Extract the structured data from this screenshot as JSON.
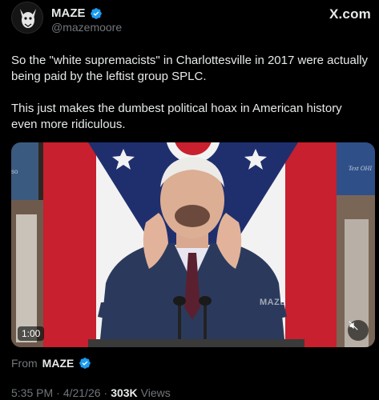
{
  "author": {
    "display_name": "MAZE",
    "handle": "@mazemoore",
    "verified_color": "#1d9bf0"
  },
  "site_logo": "X.com",
  "post": {
    "paragraph_1": "So the \"white supremacists\" in Charlottesville in 2017 were actually being paid by the leftist group SPLC.",
    "paragraph_2": "This just makes the dumbest political hoax in American history even more ridiculous."
  },
  "media": {
    "duration": "1:00",
    "watermark": "MAZE",
    "sign_text_right": "Text OHI",
    "sign_text_left": "so"
  },
  "from": {
    "label": "From",
    "name": "MAZE"
  },
  "meta": {
    "time": "5:35 PM",
    "separator_1": "·",
    "date": "4/21/26",
    "separator_2": "·",
    "views_count": "303K",
    "views_label": "Views"
  }
}
